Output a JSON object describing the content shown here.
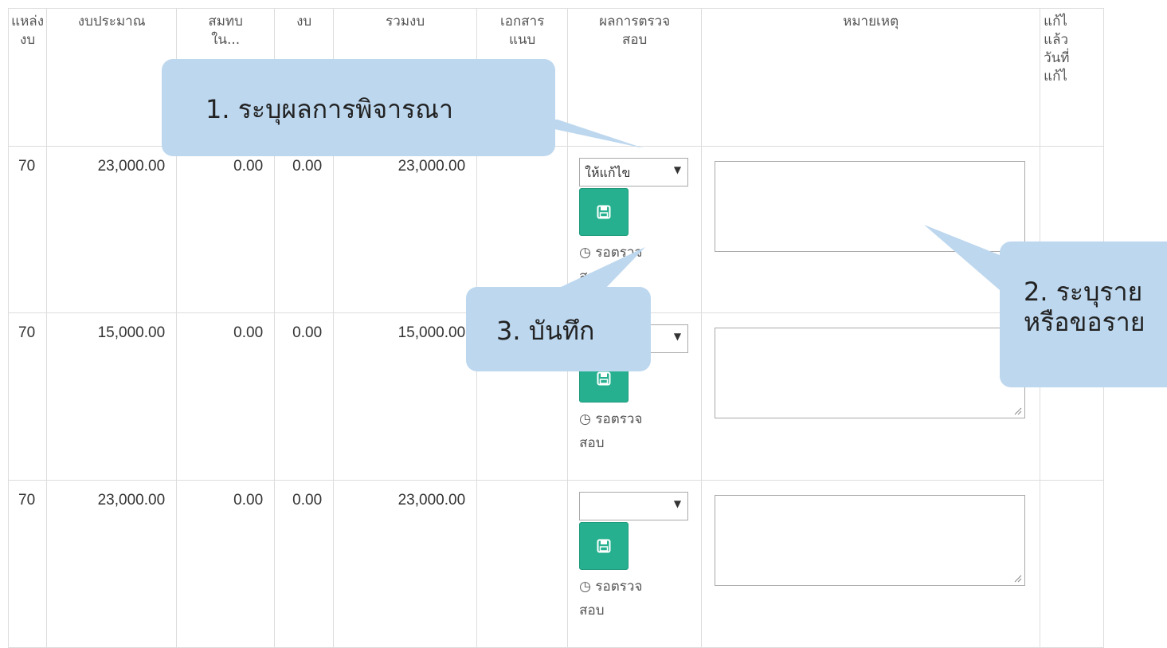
{
  "table": {
    "headers": [
      "แหล่ง\nงบ",
      "งบประมาณ",
      "สมทบ\nใน...",
      "งบ",
      "รวมงบ",
      "เอกสาร\nแนบ",
      "ผลการตรวจ\nสอบ",
      "หมายเหตุ",
      "แก้ไ\nแล้ว\nวันที่\nแก้ไ"
    ],
    "rows": [
      {
        "source": "70",
        "budget": "23,000.00",
        "co": "0.00",
        "other": "0.00",
        "total": "23,000.00",
        "result": "ให้แก้ไข",
        "status": "รอตรวจ\nสอบ"
      },
      {
        "source": "70",
        "budget": "15,000.00",
        "co": "0.00",
        "other": "0.00",
        "total": "15,000.00",
        "result": "",
        "status": "รอตรวจ\nสอบ"
      },
      {
        "source": "70",
        "budget": "23,000.00",
        "co": "0.00",
        "other": "0.00",
        "total": "23,000.00",
        "result": "",
        "status": "รอตรวจ\nสอบ"
      }
    ]
  },
  "callouts": {
    "step1": "1. ระบุผลการพิจารณา",
    "step2_line1": "2. ระบุราย",
    "step2_line2": "หรือขอราย",
    "step3": "3. บันทึก"
  },
  "colors": {
    "save_button": "#26b08f",
    "callout": "#bdd7ee",
    "border": "#dddddd"
  },
  "icons": {
    "save": "floppy-disk-icon",
    "status": "clock-icon",
    "dropdown": "triangle-down-icon"
  }
}
